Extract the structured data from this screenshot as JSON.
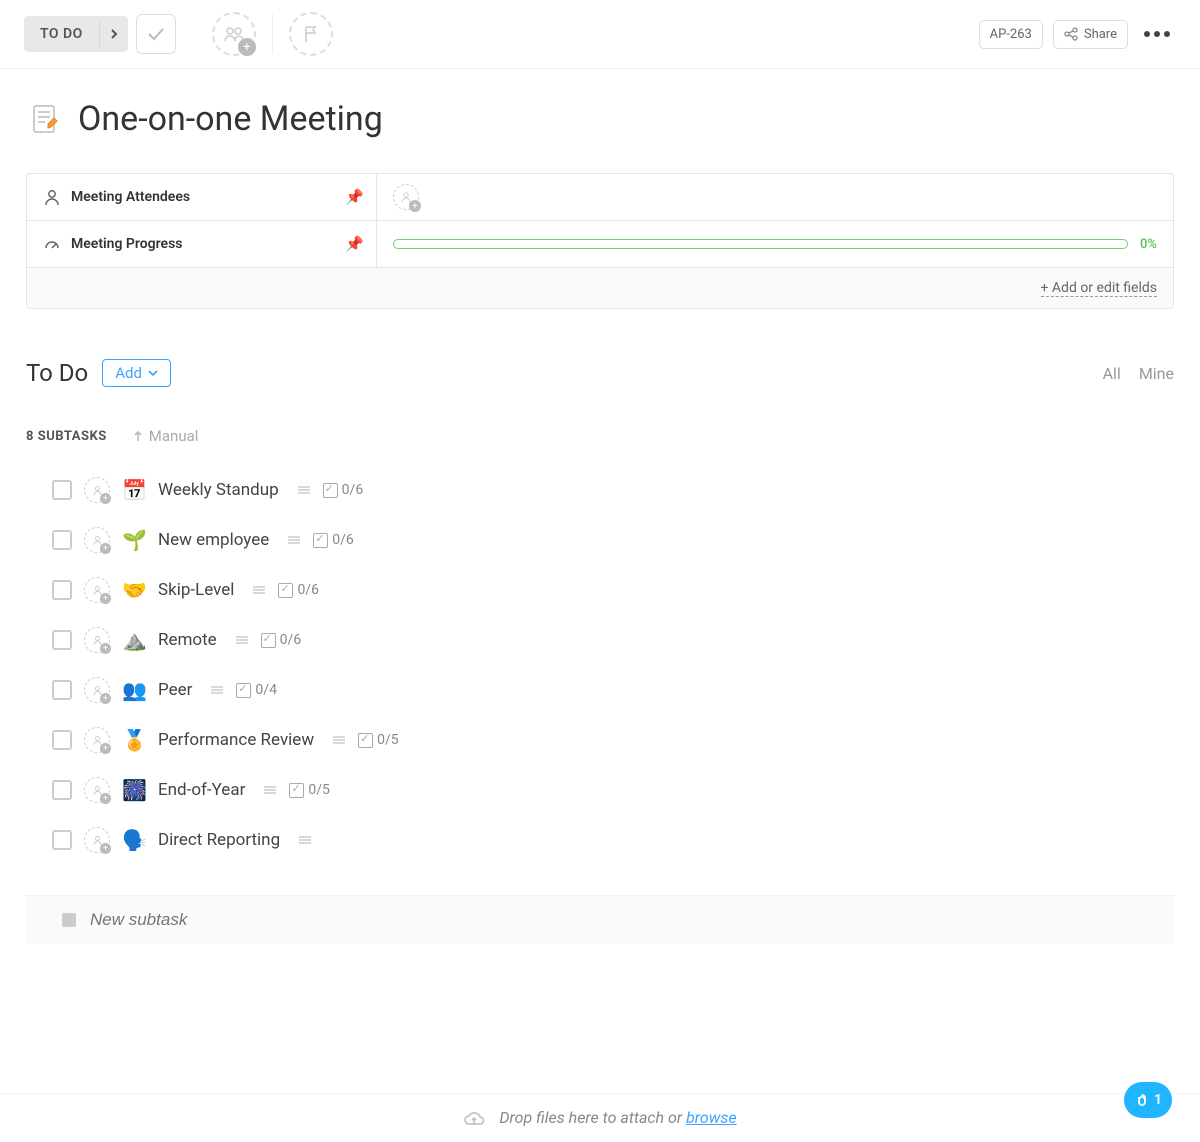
{
  "toolbar": {
    "status_label": "TO DO",
    "task_ref": "AP-263",
    "share_label": "Share"
  },
  "title": "One-on-one Meeting",
  "fields": {
    "attendees_label": "Meeting Attendees",
    "progress_label": "Meeting Progress",
    "progress_pct": "0%",
    "add_edit_label": "+ Add or edit fields"
  },
  "todo": {
    "heading": "To Do",
    "add_label": "Add",
    "filter_all": "All",
    "filter_mine": "Mine",
    "subtasks_count_label": "8 SUBTASKS",
    "sort_label": "Manual"
  },
  "subtasks": [
    {
      "emoji": "📅",
      "title": "Weekly Standup",
      "count": "0/6"
    },
    {
      "emoji": "🌱",
      "title": "New employee",
      "count": "0/6"
    },
    {
      "emoji": "🤝",
      "title": "Skip-Level",
      "count": "0/6"
    },
    {
      "emoji": "⛰️",
      "title": "Remote",
      "count": "0/6"
    },
    {
      "emoji": "👥",
      "title": "Peer",
      "count": "0/4"
    },
    {
      "emoji": "🏅",
      "title": "Performance Review",
      "count": "0/5"
    },
    {
      "emoji": "🎆",
      "title": "End-of-Year",
      "count": "0/5"
    },
    {
      "emoji": "🗣️",
      "title": "Direct Reporting",
      "count": ""
    }
  ],
  "new_subtask_placeholder": "New subtask",
  "footer": {
    "drop_text": "Drop files here to attach or ",
    "browse_label": "browse"
  },
  "fab_count": "1"
}
